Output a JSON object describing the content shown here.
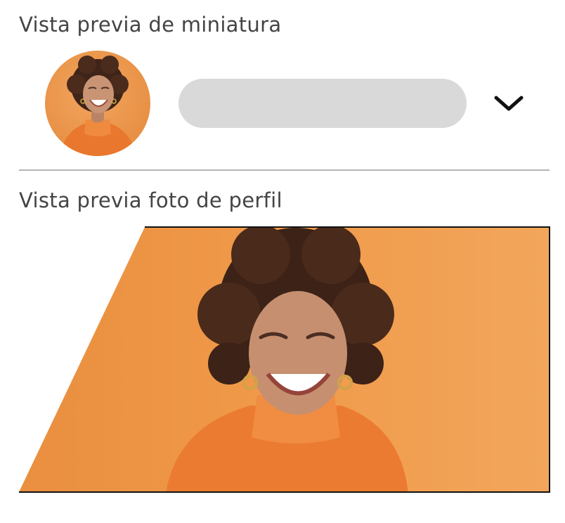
{
  "thumbnail_section": {
    "title": "Vista previa de miniatura"
  },
  "profile_section": {
    "title": "Vista previa foto de perfil"
  },
  "icons": {
    "dropdown": "chevron-down-icon"
  },
  "colors": {
    "accent_orange": "#ee9a4c",
    "title_text": "#444444",
    "name_placeholder_bar": "#d9d9d9",
    "divider": "#b5b5b5"
  }
}
